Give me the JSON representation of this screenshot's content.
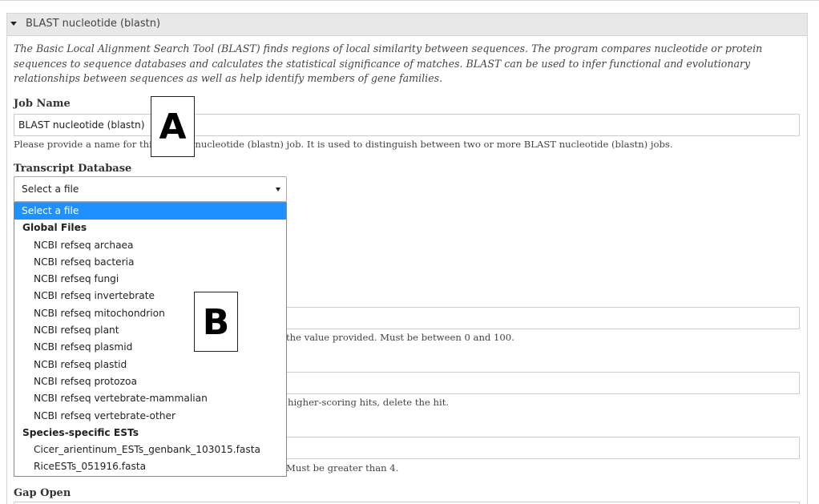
{
  "panel": {
    "title": "BLAST nucleotide (blastn)",
    "description": "The Basic Local Alignment Search Tool (BLAST) finds regions of local similarity between sequences. The program compares nucleotide or protein sequences to sequence databases and calculates the statistical significance of matches. BLAST can be used to infer functional and evolutionary relationships between sequences as well as help identify members of gene families."
  },
  "job_name": {
    "label": "Job Name",
    "value": "BLAST nucleotide (blastn)",
    "help": "Please provide a name for this BLAST nucleotide (blastn) job. It is used to distinguish between two or more BLAST nucleotide (blastn) jobs."
  },
  "transcript_db": {
    "label": "Transcript Database",
    "selected": "Select a file",
    "options": {
      "placeholder": "Select a file",
      "group_global": "Global Files",
      "global": [
        "NCBI refseq archaea",
        "NCBI refseq bacteria",
        "NCBI refseq fungi",
        "NCBI refseq invertebrate",
        "NCBI refseq mitochondrion",
        "NCBI refseq plant",
        "NCBI refseq plasmid",
        "NCBI refseq plastid",
        "NCBI refseq protozoa",
        "NCBI refseq vertebrate-mammalian",
        "NCBI refseq vertebrate-other"
      ],
      "group_species": "Species-specific ESTs",
      "species": [
        "Cicer_arientinum_ESTs_genbank_103015.fasta",
        "RiceESTs_051916.fasta"
      ]
    }
  },
  "hidden_help": {
    "help1": "the value provided. Must be between 0 and 100.",
    "help2": "higher-scoring hits, delete the hit.",
    "help3": "Must be greater than 4."
  },
  "gap_open": {
    "label": "Gap Open"
  },
  "callouts": {
    "a": "A",
    "b": "B"
  }
}
